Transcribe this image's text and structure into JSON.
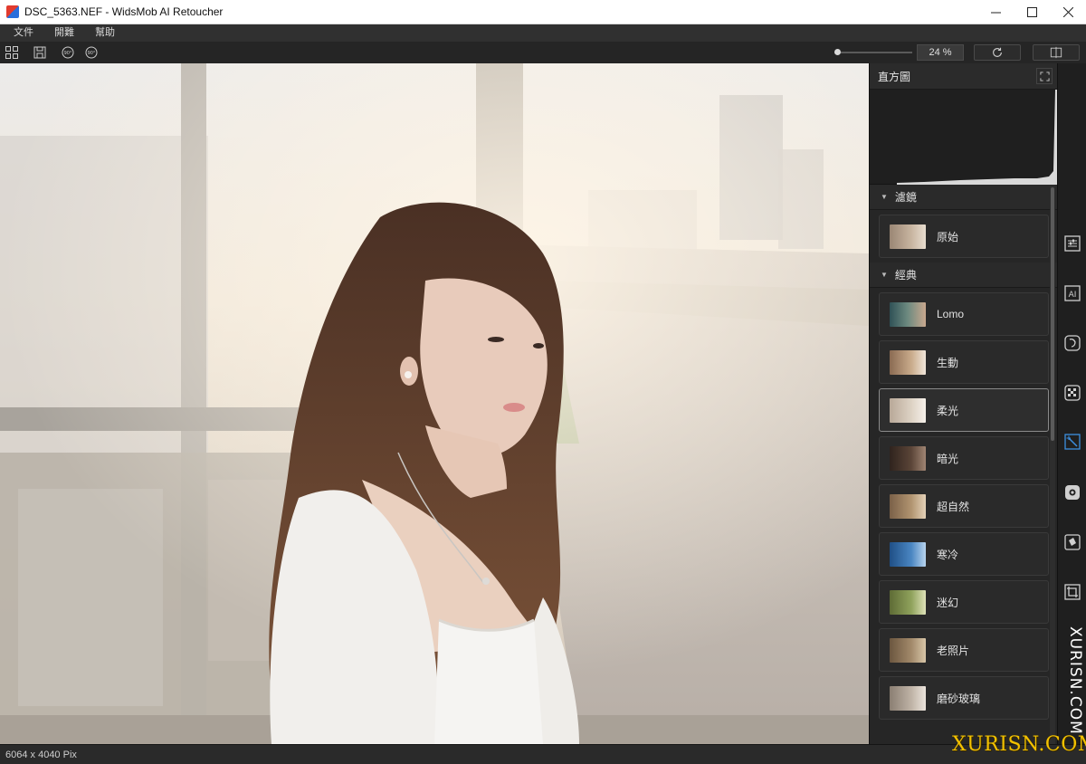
{
  "window": {
    "title": "DSC_5363.NEF - WidsMob AI Retoucher",
    "minimize_icon": "minimize-icon",
    "maximize_icon": "maximize-icon",
    "close_icon": "close-icon"
  },
  "menu": {
    "items": [
      "文件",
      "開難",
      "幫助"
    ]
  },
  "toolbar": {
    "zoom_percent": "24 %",
    "zoom_level": 0.24,
    "icons": [
      "grid-icon",
      "save-icon",
      "rotate-left-90-icon",
      "rotate-right-90-icon",
      "refresh-icon",
      "compare-icon"
    ]
  },
  "panel": {
    "histogram_title": "直方圖",
    "sections": [
      {
        "title": "濾鏡",
        "items": [
          {
            "label": "原始",
            "thumb": "#b9a48f"
          }
        ]
      },
      {
        "title": "經典",
        "items": [
          {
            "label": "Lomo",
            "thumb": "#3f6a6e"
          },
          {
            "label": "生動",
            "thumb": "#c9ab8b"
          },
          {
            "label": "柔光",
            "thumb": "#ddd2c4",
            "selected": true
          },
          {
            "label": "暗光",
            "thumb": "#5b4538"
          },
          {
            "label": "超自然",
            "thumb": "#b19470"
          },
          {
            "label": "寒冷",
            "thumb": "#4a86c2"
          },
          {
            "label": "迷幻",
            "thumb": "#8fa25c"
          },
          {
            "label": "老照片",
            "thumb": "#a2896a"
          },
          {
            "label": "磨砂玻璃",
            "thumb": "#bfb3a6"
          }
        ]
      }
    ]
  },
  "rail": {
    "icons": [
      "adjust-sliders-icon",
      "ai-icon",
      "face-icon",
      "noise-icon",
      "magic-wand-icon",
      "settings-gear-icon",
      "layers-icon",
      "crop-icon"
    ]
  },
  "status": {
    "dimensions": "6064 x 4040 Pix"
  },
  "watermark": {
    "vertical": "XURISN.COM",
    "corner": "XURISN.COM"
  }
}
